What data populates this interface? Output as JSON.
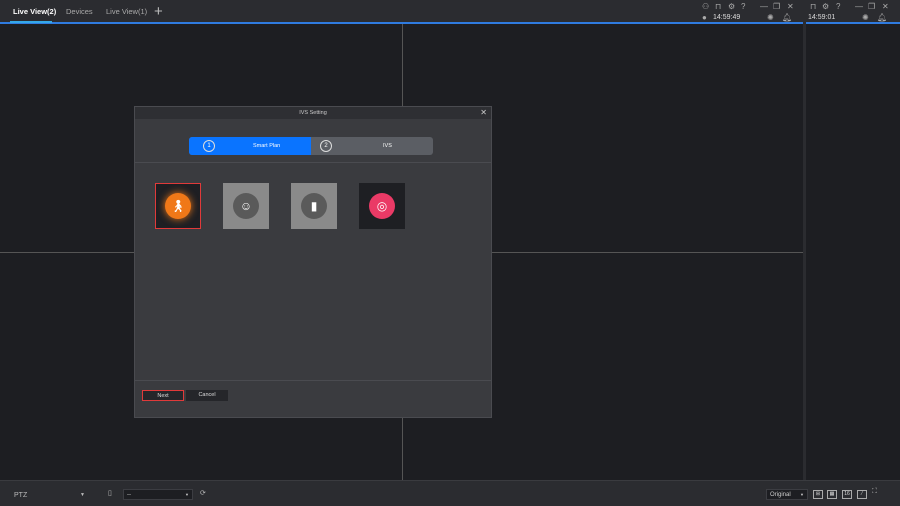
{
  "tabs": [
    {
      "label": "Live View(2)",
      "active": true
    },
    {
      "label": "Devices"
    },
    {
      "label": "Live View(1)"
    }
  ],
  "add_tab": "+",
  "pane1": {
    "time": "14:59:49"
  },
  "pane2": {
    "time": "14:59:01"
  },
  "dialog": {
    "title": "IVS Setting",
    "close": "✕",
    "steps": [
      {
        "num": "1",
        "label": "Smart Plan"
      },
      {
        "num": "2",
        "label": "IVS"
      }
    ],
    "plans": [
      {
        "icon": "people-walking-icon",
        "selected": true,
        "color": "#f07818"
      },
      {
        "icon": "face-detection-icon",
        "color": "#8a8a8a"
      },
      {
        "icon": "people-counting-icon",
        "color": "#8a8a8a"
      },
      {
        "icon": "heat-map-icon",
        "color": "#ea3a66"
      }
    ],
    "next": "Next",
    "cancel": "Cancel"
  },
  "bottom": {
    "ptz": "PTZ",
    "preset": "--",
    "ratio": "Original",
    "grid16": "16"
  },
  "colors": {
    "accent": "#0a74ff",
    "highlight": "#e03a3a"
  }
}
